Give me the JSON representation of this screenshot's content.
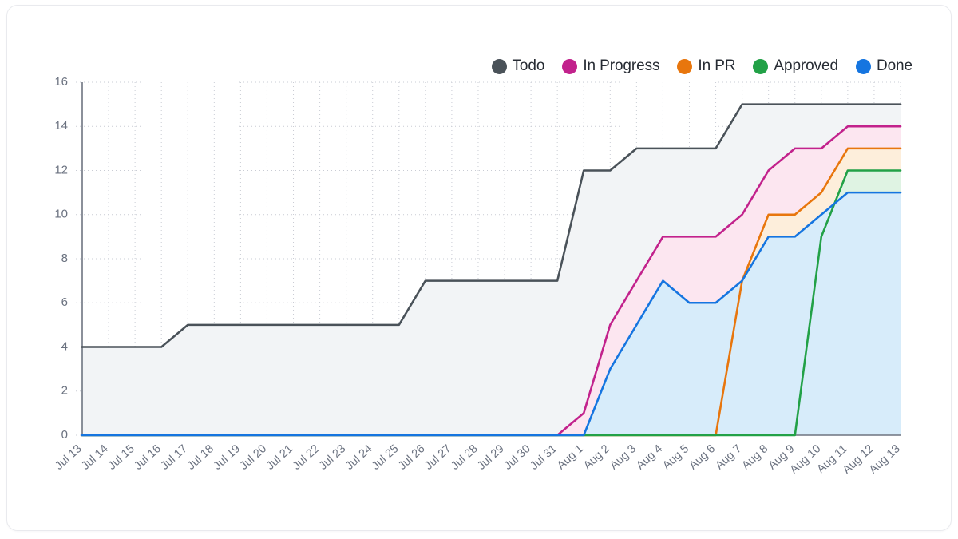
{
  "card": {
    "background": "#ffffff",
    "border_color": "#e9eaee"
  },
  "legend": {
    "position": "top-right",
    "items": [
      {
        "label": "Todo",
        "color": "#4a5259",
        "icon": "legend-dot-icon"
      },
      {
        "label": "In Progress",
        "color": "#c2228c",
        "icon": "legend-dot-icon"
      },
      {
        "label": "In PR",
        "color": "#e8760d",
        "icon": "legend-dot-icon"
      },
      {
        "label": "Approved",
        "color": "#22a147",
        "icon": "legend-dot-icon"
      },
      {
        "label": "Done",
        "color": "#1575e0",
        "icon": "legend-dot-icon"
      }
    ]
  },
  "axes": {
    "y_ticks": [
      "0",
      "2",
      "4",
      "6",
      "8",
      "10",
      "12",
      "14",
      "16"
    ],
    "x_ticks": [
      "Jul 13",
      "Jul 14",
      "Jul 15",
      "Jul 16",
      "Jul 17",
      "Jul 18",
      "Jul 19",
      "Jul 20",
      "Jul 21",
      "Jul 22",
      "Jul 23",
      "Jul 24",
      "Jul 25",
      "Jul 26",
      "Jul 27",
      "Jul 28",
      "Jul 29",
      "Jul 30",
      "Jul 31",
      "Aug 1",
      "Aug 2",
      "Aug 3",
      "Aug 4",
      "Aug 5",
      "Aug 6",
      "Aug 7",
      "Aug 8",
      "Aug 9",
      "Aug 10",
      "Aug 11",
      "Aug 12",
      "Aug 13"
    ]
  },
  "chart_data": {
    "type": "area",
    "title": "",
    "subtitle": "",
    "xlabel": "",
    "ylabel": "",
    "ylim": [
      0,
      16
    ],
    "ytick_step": 2,
    "grid": true,
    "legend_position": "top-right",
    "stacked": false,
    "cumulative_flow": true,
    "categories": [
      "Jul 13",
      "Jul 14",
      "Jul 15",
      "Jul 16",
      "Jul 17",
      "Jul 18",
      "Jul 19",
      "Jul 20",
      "Jul 21",
      "Jul 22",
      "Jul 23",
      "Jul 24",
      "Jul 25",
      "Jul 26",
      "Jul 27",
      "Jul 28",
      "Jul 29",
      "Jul 30",
      "Jul 31",
      "Aug 1",
      "Aug 2",
      "Aug 3",
      "Aug 4",
      "Aug 5",
      "Aug 6",
      "Aug 7",
      "Aug 8",
      "Aug 9",
      "Aug 10",
      "Aug 11",
      "Aug 12",
      "Aug 13"
    ],
    "series": [
      {
        "name": "Todo",
        "color": "#4a5259",
        "fill": "#f2f4f6",
        "values": [
          4,
          4,
          4,
          4,
          5,
          5,
          5,
          5,
          5,
          5,
          5,
          5,
          5,
          7,
          7,
          7,
          7,
          7,
          7,
          12,
          12,
          13,
          13,
          13,
          13,
          15,
          15,
          15,
          15,
          15,
          15,
          15
        ]
      },
      {
        "name": "In Progress",
        "color": "#c2228c",
        "fill": "#fce6f0",
        "values": [
          0,
          0,
          0,
          0,
          0,
          0,
          0,
          0,
          0,
          0,
          0,
          0,
          0,
          0,
          0,
          0,
          0,
          0,
          0,
          1,
          5,
          7,
          9,
          9,
          9,
          10,
          12,
          13,
          13,
          14,
          14,
          14
        ]
      },
      {
        "name": "In PR",
        "color": "#e8760d",
        "fill": "#fdeedb",
        "values": [
          0,
          0,
          0,
          0,
          0,
          0,
          0,
          0,
          0,
          0,
          0,
          0,
          0,
          0,
          0,
          0,
          0,
          0,
          0,
          0,
          0,
          0,
          0,
          0,
          0,
          7,
          10,
          10,
          11,
          13,
          13,
          13
        ]
      },
      {
        "name": "Approved",
        "color": "#22a147",
        "fill": "#dff3e3",
        "values": [
          0,
          0,
          0,
          0,
          0,
          0,
          0,
          0,
          0,
          0,
          0,
          0,
          0,
          0,
          0,
          0,
          0,
          0,
          0,
          0,
          0,
          0,
          0,
          0,
          0,
          0,
          0,
          0,
          9,
          12,
          12,
          12
        ]
      },
      {
        "name": "Done",
        "color": "#1575e0",
        "fill": "#d7ecfa",
        "values": [
          0,
          0,
          0,
          0,
          0,
          0,
          0,
          0,
          0,
          0,
          0,
          0,
          0,
          0,
          0,
          0,
          0,
          0,
          0,
          0,
          3,
          5,
          7,
          6,
          6,
          7,
          9,
          9,
          10,
          11,
          11,
          11
        ]
      }
    ]
  }
}
